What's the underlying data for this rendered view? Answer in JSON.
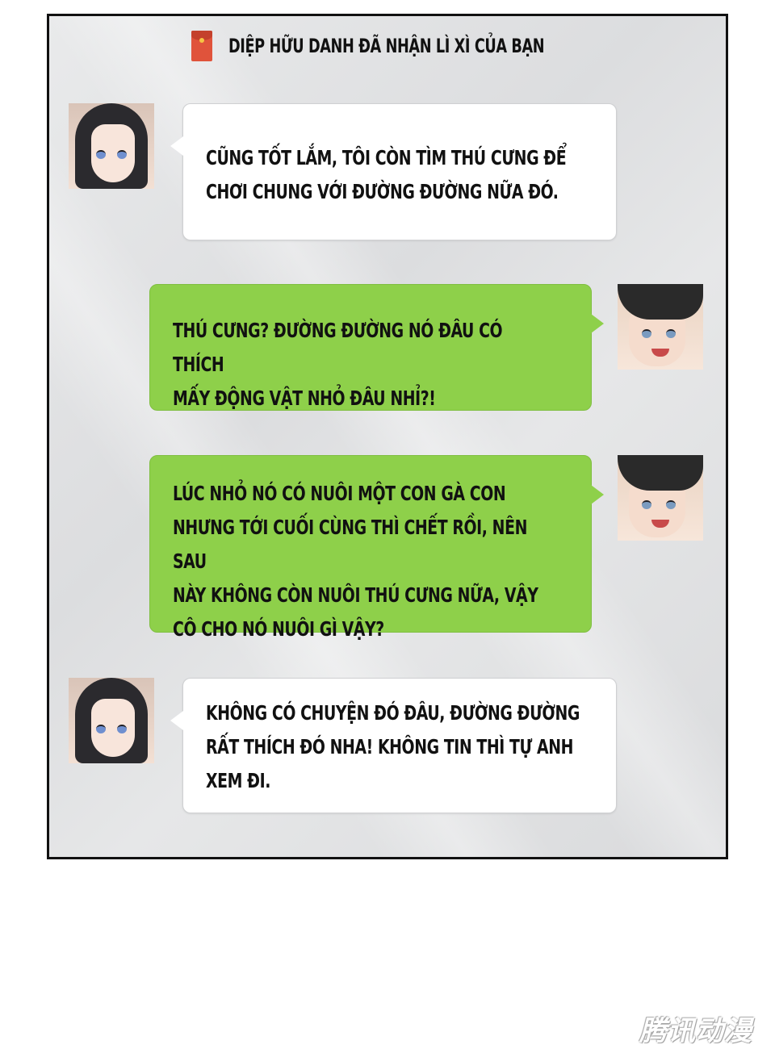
{
  "notice": {
    "icon": "red-envelope-icon",
    "text": "DIỆP HỮU DANH ĐÃ NHẬN LÌ XÌ CỦA BẠN"
  },
  "messages": [
    {
      "sender": "girl",
      "lines": [
        "CŨNG TỐT LẮM, TÔI CÒN TÌM THÚ CƯNG ĐỂ",
        "CHƠI CHUNG VỚI ĐƯỜNG ĐƯỜNG NỮA ĐÓ."
      ]
    },
    {
      "sender": "boy",
      "lines": [
        "THÚ CƯNG? ĐƯỜNG ĐƯỜNG NÓ ĐÂU CÓ THÍCH",
        "MẤY ĐỘNG VẬT NHỎ ĐÂU NHỈ?!"
      ]
    },
    {
      "sender": "boy",
      "lines": [
        "LÚC NHỎ NÓ CÓ NUÔI MỘT CON GÀ CON",
        "NHƯNG TỚI CUỐI CÙNG THÌ CHẾT RỒI, NÊN SAU",
        "NÀY KHÔNG CÒN NUÔI THÚ CƯNG NỮA, VẬY",
        "CÔ CHO NÓ NUÔI GÌ VẬY?"
      ]
    },
    {
      "sender": "girl",
      "lines": [
        "KHÔNG CÓ CHUYỆN ĐÓ ĐÂU, ĐƯỜNG ĐƯỜNG",
        "RẤT THÍCH ĐÓ NHA! KHÔNG TIN THÌ TỰ ANH",
        "XEM ĐI."
      ]
    }
  ],
  "watermark": "腾讯动漫",
  "colors": {
    "green_bubble": "#8ed04a",
    "white_bubble": "#ffffff",
    "envelope": "#e0533b"
  }
}
